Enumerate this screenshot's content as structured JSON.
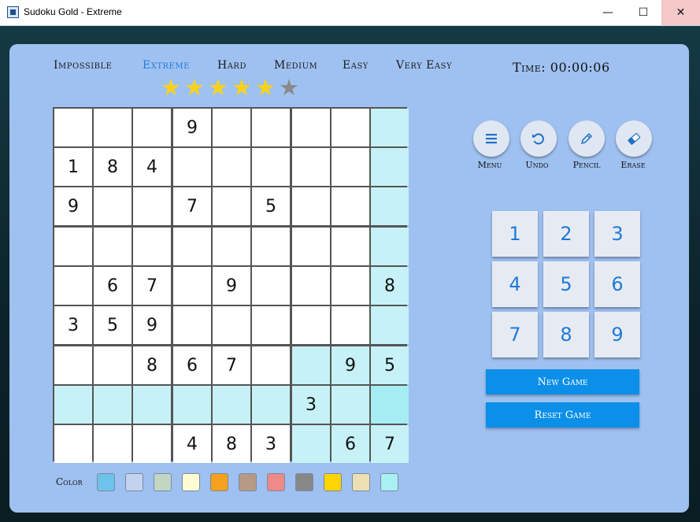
{
  "window": {
    "title": "Sudoku Gold - Extreme",
    "minimize_glyph": "—",
    "maximize_glyph": "☐",
    "close_glyph": "✕"
  },
  "difficulties": [
    {
      "label": "Impossible",
      "active": false
    },
    {
      "label": "Extreme",
      "active": true
    },
    {
      "label": "Hard",
      "active": false
    },
    {
      "label": "Medium",
      "active": false
    },
    {
      "label": "Easy",
      "active": false
    },
    {
      "label": "Very Easy",
      "active": false
    }
  ],
  "rating": {
    "filled": 5,
    "total": 6
  },
  "timer": {
    "label": "Time:",
    "value": "00:00:06"
  },
  "board": {
    "rows": [
      [
        "",
        "",
        "",
        "9",
        "",
        "",
        "",
        "",
        ""
      ],
      [
        "1",
        "8",
        "4",
        "",
        "",
        "",
        "",
        "",
        ""
      ],
      [
        "9",
        "",
        "",
        "7",
        "",
        "5",
        "",
        "",
        ""
      ],
      [
        "",
        "",
        "",
        "",
        "",
        "",
        "",
        "",
        ""
      ],
      [
        "",
        "6",
        "7",
        "",
        "9",
        "",
        "",
        "",
        "8"
      ],
      [
        "3",
        "5",
        "9",
        "",
        "",
        "",
        "",
        "",
        ""
      ],
      [
        "",
        "",
        "8",
        "6",
        "7",
        "",
        "",
        "9",
        "5"
      ],
      [
        "",
        "",
        "",
        "",
        "",
        "",
        "3",
        "",
        ""
      ],
      [
        "",
        "",
        "",
        "4",
        "8",
        "3",
        "",
        "6",
        "7"
      ]
    ],
    "selected": {
      "row": 8,
      "col": 9
    },
    "highlight_color": "#c6f2f7",
    "selected_color": "#a6ecf3"
  },
  "actions": [
    {
      "label": "Menu",
      "icon": "menu-icon"
    },
    {
      "label": "Undo",
      "icon": "undo-icon"
    },
    {
      "label": "Pencil",
      "icon": "pencil-icon"
    },
    {
      "label": "Erase",
      "icon": "eraser-icon"
    }
  ],
  "keypad": [
    "1",
    "2",
    "3",
    "4",
    "5",
    "6",
    "7",
    "8",
    "9"
  ],
  "buttons": {
    "new_game": "New Game",
    "reset_game": "Reset Game"
  },
  "colors": {
    "label": "Color",
    "swatches": [
      "#6ec3ea",
      "#c3d3ef",
      "#c2d6c4",
      "#fffcd3",
      "#f5a11d",
      "#b69a86",
      "#ef8a8a",
      "#878787",
      "#ffd400",
      "#ece0b3",
      "#a8f0f2"
    ]
  },
  "theme": {
    "panel": "#9fc1f1",
    "accent": "#1f7ad6",
    "button": "#0b8fe8"
  }
}
